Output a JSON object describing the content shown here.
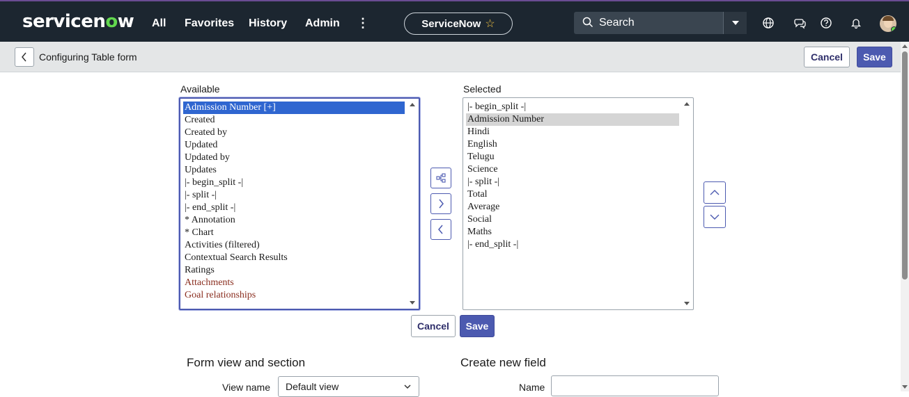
{
  "nav": {
    "logo_text_a": "servicen",
    "logo_text_o": "o",
    "logo_text_b": "w",
    "links": [
      "All",
      "Favorites",
      "History",
      "Admin"
    ],
    "more": "⋮",
    "instance_pill": "ServiceNow",
    "search_placeholder": "Search",
    "accent_color": "#62d84e"
  },
  "header": {
    "title": "Configuring Table form",
    "cancel": "Cancel",
    "save": "Save"
  },
  "slushbucket": {
    "available_label": "Available",
    "selected_label": "Selected",
    "available": [
      {
        "text": "Admission Number [+]",
        "state": "active"
      },
      {
        "text": "Created",
        "state": ""
      },
      {
        "text": "Created by",
        "state": ""
      },
      {
        "text": "Updated",
        "state": ""
      },
      {
        "text": "Updated by",
        "state": ""
      },
      {
        "text": "Updates",
        "state": ""
      },
      {
        "text": "|- begin_split -|",
        "state": ""
      },
      {
        "text": "|- split -|",
        "state": ""
      },
      {
        "text": "|- end_split -|",
        "state": ""
      },
      {
        "text": "* Annotation",
        "state": ""
      },
      {
        "text": "* Chart",
        "state": ""
      },
      {
        "text": "Activities (filtered)",
        "state": ""
      },
      {
        "text": "Contextual Search Results",
        "state": ""
      },
      {
        "text": "Ratings",
        "state": ""
      },
      {
        "text": "Attachments",
        "state": "rel"
      },
      {
        "text": "Goal relationships",
        "state": "rel"
      }
    ],
    "selected": [
      {
        "text": "|- begin_split -|",
        "state": ""
      },
      {
        "text": "Admission Number",
        "state": "grey"
      },
      {
        "text": "Hindi",
        "state": ""
      },
      {
        "text": "English",
        "state": ""
      },
      {
        "text": "Telugu",
        "state": ""
      },
      {
        "text": "Science",
        "state": ""
      },
      {
        "text": "|- split -|",
        "state": ""
      },
      {
        "text": "Total",
        "state": ""
      },
      {
        "text": "Average",
        "state": ""
      },
      {
        "text": "Social",
        "state": ""
      },
      {
        "text": "Maths",
        "state": ""
      },
      {
        "text": "|- end_split -|",
        "state": ""
      }
    ],
    "cancel": "Cancel",
    "save": "Save"
  },
  "form_view": {
    "heading": "Form view and section",
    "view_name_label": "View name",
    "view_name_value": "Default view"
  },
  "create_field": {
    "heading": "Create new field",
    "name_label": "Name",
    "name_value": ""
  }
}
